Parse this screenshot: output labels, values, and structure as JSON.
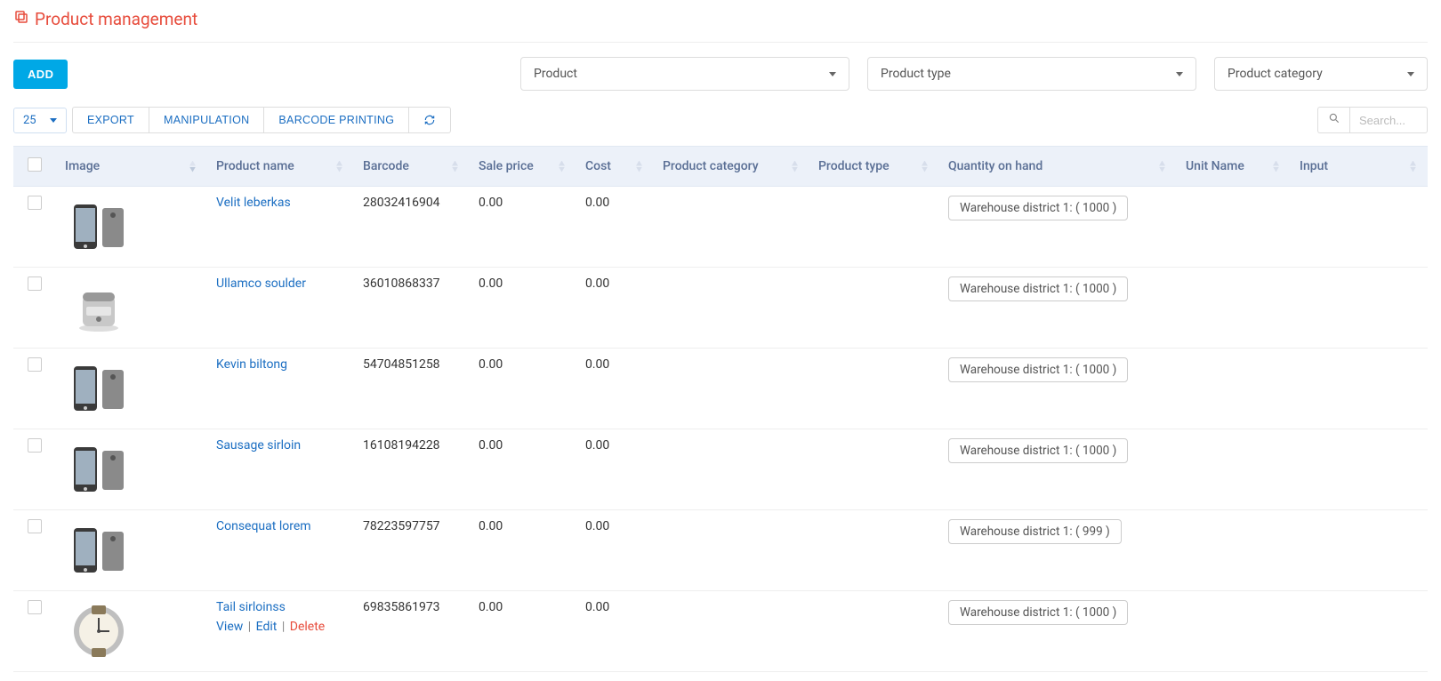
{
  "page": {
    "title": "Product management"
  },
  "toolbar": {
    "add_label": "ADD",
    "export_label": "EXPORT",
    "manipulation_label": "MANIPULATION",
    "barcode_label": "BARCODE PRINTING",
    "page_size": "25",
    "search_placeholder": "Search..."
  },
  "filters": {
    "product": {
      "placeholder": "Product"
    },
    "product_type": {
      "placeholder": "Product type"
    },
    "product_category": {
      "placeholder": "Product category"
    }
  },
  "table": {
    "columns": {
      "image": "Image",
      "product_name": "Product name",
      "barcode": "Barcode",
      "sale_price": "Sale price",
      "cost": "Cost",
      "product_category": "Product category",
      "product_type": "Product type",
      "quantity_on_hand": "Quantity on hand",
      "unit_name": "Unit Name",
      "input": "Input"
    },
    "rows": [
      {
        "name": "Velit leberkas",
        "barcode": "28032416904",
        "sale_price": "0.00",
        "cost": "0.00",
        "category": "",
        "type": "",
        "qty": "Warehouse district 1: ( 1000 )",
        "unit": "",
        "input": "",
        "img": "phone"
      },
      {
        "name": "Ullamco soulder",
        "barcode": "36010868337",
        "sale_price": "0.00",
        "cost": "0.00",
        "category": "",
        "type": "",
        "qty": "Warehouse district 1: ( 1000 )",
        "unit": "",
        "input": "",
        "img": "fryer"
      },
      {
        "name": "Kevin biltong",
        "barcode": "54704851258",
        "sale_price": "0.00",
        "cost": "0.00",
        "category": "",
        "type": "",
        "qty": "Warehouse district 1: ( 1000 )",
        "unit": "",
        "input": "",
        "img": "phone"
      },
      {
        "name": "Sausage sirloin",
        "barcode": "16108194228",
        "sale_price": "0.00",
        "cost": "0.00",
        "category": "",
        "type": "",
        "qty": "Warehouse district 1: ( 1000 )",
        "unit": "",
        "input": "",
        "img": "phone"
      },
      {
        "name": "Consequat lorem",
        "barcode": "78223597757",
        "sale_price": "0.00",
        "cost": "0.00",
        "category": "",
        "type": "",
        "qty": "Warehouse district 1: ( 999 )",
        "unit": "",
        "input": "",
        "img": "phone"
      },
      {
        "name": "Tail sirloinss",
        "barcode": "69835861973",
        "sale_price": "0.00",
        "cost": "0.00",
        "category": "",
        "type": "",
        "qty": "Warehouse district 1: ( 1000 )",
        "unit": "",
        "input": "",
        "img": "watch",
        "show_actions": true
      }
    ],
    "row_actions": {
      "view": "View",
      "edit": "Edit",
      "delete": "Delete"
    }
  }
}
